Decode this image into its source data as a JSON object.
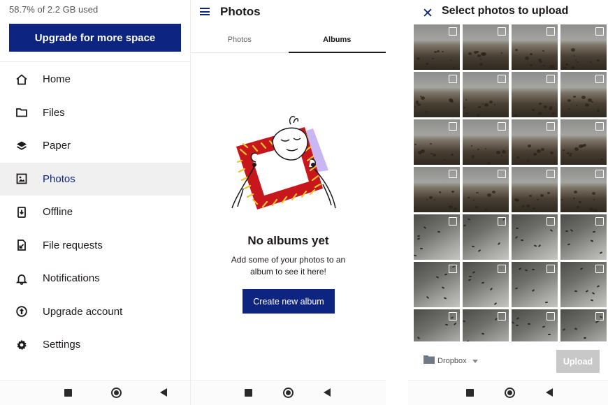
{
  "drawer": {
    "storage_text": "58.7% of 2.2 GB used",
    "upgrade_button": "Upgrade for more space",
    "items": [
      {
        "label": "Home",
        "icon": "home-icon"
      },
      {
        "label": "Files",
        "icon": "folder-icon"
      },
      {
        "label": "Paper",
        "icon": "layers-icon"
      },
      {
        "label": "Photos",
        "icon": "photo-icon",
        "active": true
      },
      {
        "label": "Offline",
        "icon": "offline-icon"
      },
      {
        "label": "File requests",
        "icon": "file-request-icon"
      },
      {
        "label": "Notifications",
        "icon": "bell-icon"
      },
      {
        "label": "Upgrade account",
        "icon": "upgrade-icon"
      },
      {
        "label": "Settings",
        "icon": "gear-icon"
      }
    ]
  },
  "photos_screen": {
    "title": "Photos",
    "tabs": [
      {
        "label": "Photos",
        "active": false
      },
      {
        "label": "Albums",
        "active": true
      }
    ],
    "empty_title": "No albums yet",
    "empty_subtitle": "Add some of your photos to an album to see it here!",
    "create_button": "Create new album"
  },
  "upload_screen": {
    "title": "Select photos to upload",
    "folder_label": "Dropbox",
    "upload_button": "Upload",
    "thumbnail_count": 28
  },
  "colors": {
    "brand_blue": "#0d2481",
    "frame_red": "#c8161d",
    "frame_yellow": "#f6c12b",
    "accent_lavender": "#c9b6f2"
  }
}
